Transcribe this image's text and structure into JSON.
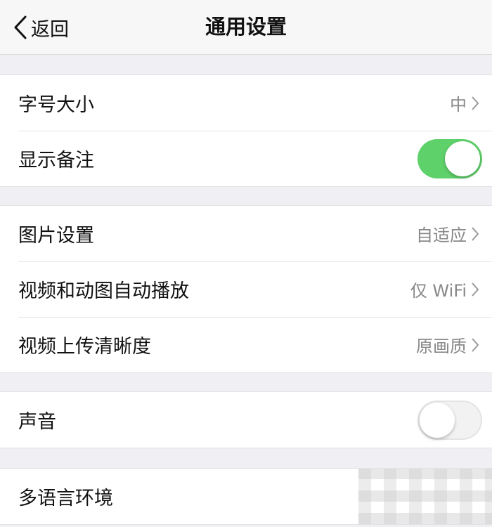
{
  "navbar": {
    "back_label": "返回",
    "title": "通用设置"
  },
  "groups": [
    {
      "items": [
        {
          "label": "字号大小",
          "value": "中",
          "type": "link"
        },
        {
          "label": "显示备注",
          "type": "toggle",
          "on": true
        }
      ]
    },
    {
      "items": [
        {
          "label": "图片设置",
          "value": "自适应",
          "type": "link"
        },
        {
          "label": "视频和动图自动播放",
          "value": "仅 WiFi",
          "type": "link"
        },
        {
          "label": "视频上传清晰度",
          "value": "原画质",
          "type": "link"
        }
      ]
    },
    {
      "items": [
        {
          "label": "声音",
          "type": "toggle",
          "on": false
        }
      ]
    },
    {
      "items": [
        {
          "label": "多语言环境",
          "type": "link"
        }
      ]
    }
  ],
  "colors": {
    "toggle_on": "#5fd16a",
    "background": "#efeff4"
  },
  "icons": {
    "back": "chevron-left-icon",
    "row_arrow": "chevron-right-icon"
  }
}
